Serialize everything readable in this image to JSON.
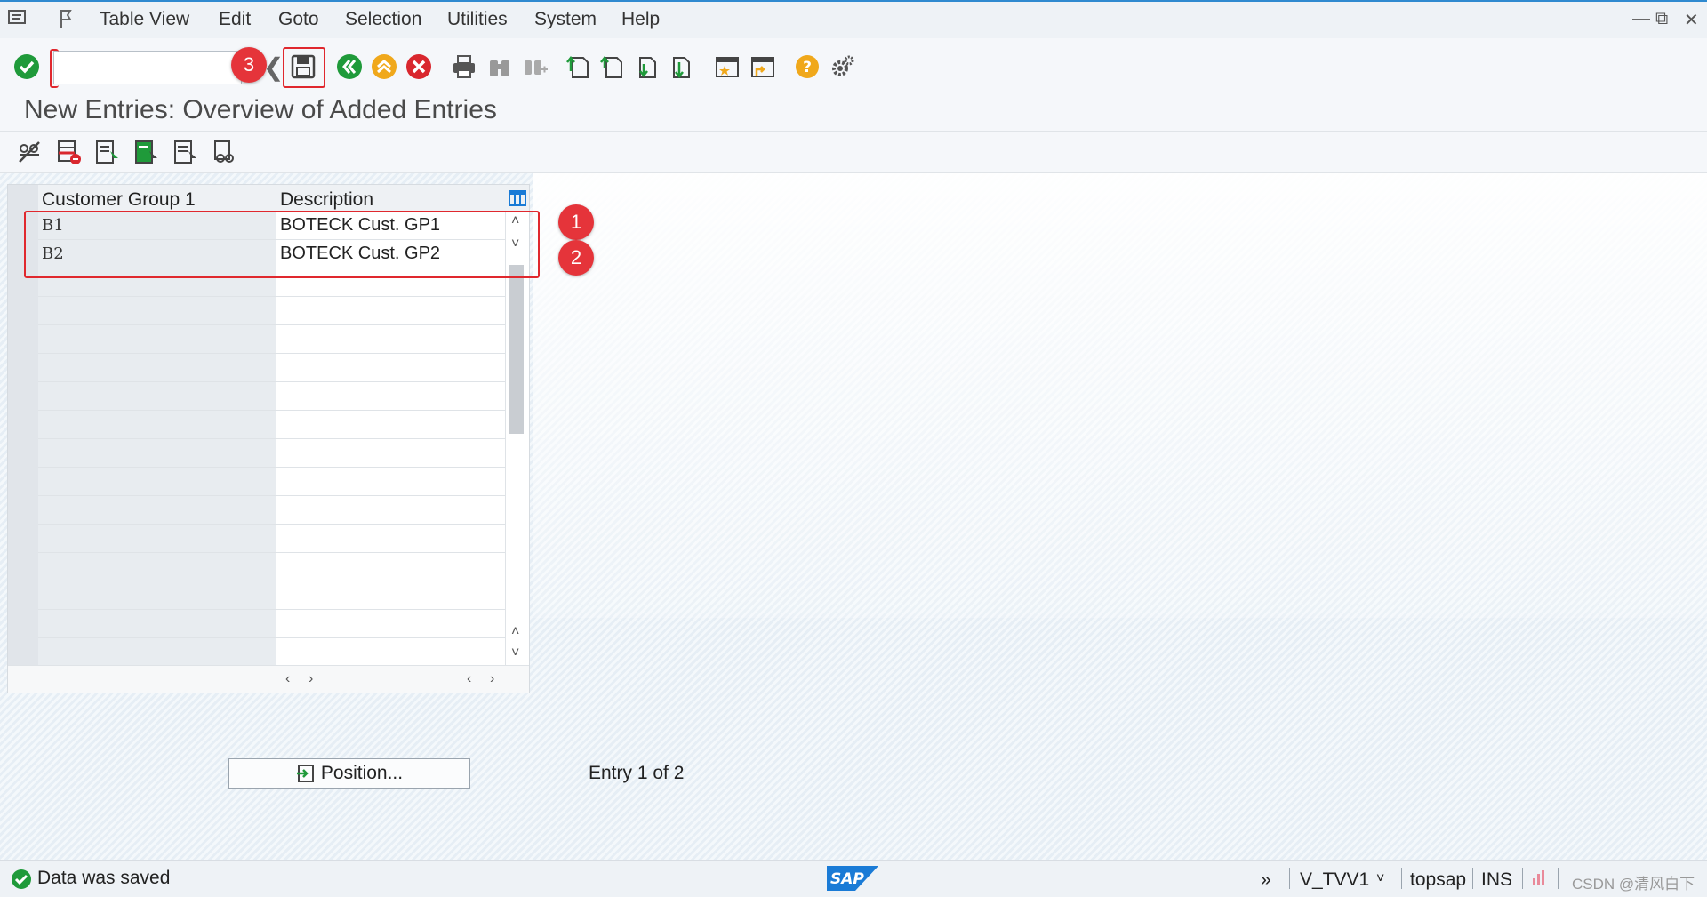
{
  "menu": {
    "items": [
      {
        "id": "table_view",
        "label": "Table View"
      },
      {
        "id": "edit",
        "label": "Edit"
      },
      {
        "id": "goto",
        "label": "Goto"
      },
      {
        "id": "selection",
        "label": "Selection"
      },
      {
        "id": "utilities",
        "label": "Utilities"
      },
      {
        "id": "system",
        "label": "System"
      },
      {
        "id": "help",
        "label": "Help"
      }
    ]
  },
  "toolbar": {
    "command_field_value": "",
    "icons": [
      "check-icon",
      "save-icon",
      "back-icon",
      "exit-icon",
      "cancel-icon",
      "print-icon",
      "find-icon",
      "find-next-icon",
      "first-page-icon",
      "prev-page-icon",
      "next-page-icon",
      "last-page-icon",
      "new-session-icon",
      "shortcut-icon",
      "help-icon",
      "settings-icon"
    ]
  },
  "page_title": "New Entries: Overview of Added Entries",
  "table": {
    "columns": [
      "Customer Group 1",
      "Description"
    ],
    "rows": [
      {
        "key": "B1",
        "description": "BOTECK Cust. GP1"
      },
      {
        "key": "B2",
        "description": "BOTECK Cust. GP2"
      }
    ],
    "empty_rows": 14
  },
  "annotations": {
    "badge1": "1",
    "badge2": "2",
    "badge3": "3",
    "color": "#e5343a"
  },
  "position_button": "Position...",
  "entry_info": "Entry 1 of 2",
  "status": {
    "message": "Data was saved",
    "transaction": "V_TVV1",
    "server": "topsap",
    "mode": "INS",
    "watermark": "CSDN @清风白下"
  },
  "colors": {
    "accent_blue": "#2f8ad0",
    "success_green": "#1f9a3a",
    "cancel_red": "#d9272e",
    "exit_orange": "#f0a81b",
    "sap_blue": "#1a7bd6"
  }
}
